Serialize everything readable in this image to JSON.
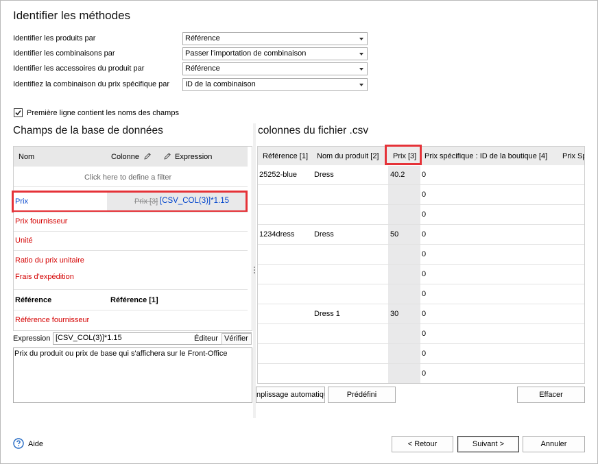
{
  "header": {
    "title": "Identifier les méthodes"
  },
  "methods": [
    {
      "label": "Identifier les produits par",
      "value": "Référence"
    },
    {
      "label": "Identifier les combinaisons par",
      "value": "Passer l'importation de combinaison"
    },
    {
      "label": "Identifier les accessoires du produit par",
      "value": "Référence"
    },
    {
      "label": "Identifiez la combinaison du prix spécifique par",
      "value": "ID de la combinaison"
    }
  ],
  "first_line_checkbox": {
    "label": "Première ligne contient les noms des champs",
    "checked": true
  },
  "db_fields": {
    "title": "Champs de la base de données",
    "col_name": "Nom",
    "col_column": "Colonne",
    "col_expression": "Expression",
    "filter_hint": "Click here to define a filter",
    "rows": [
      {
        "name": "Prix",
        "column": "Prix [3]",
        "expression": "[CSV_COL(3)]*1.15"
      },
      {
        "name": "Prix fournisseur",
        "column": "",
        "expression": ""
      },
      {
        "name": "Unité",
        "column": "",
        "expression": ""
      },
      {
        "name": "Ratio du prix unitaire",
        "column": "",
        "expression": ""
      },
      {
        "name": "Frais d'expédition",
        "column": "",
        "expression": ""
      },
      {
        "name": "Référence",
        "column": "Référence [1]",
        "expression": ""
      },
      {
        "name": "Référence fournisseur",
        "column": "",
        "expression": ""
      }
    ]
  },
  "expression_bar": {
    "label": "Expression",
    "value": "[CSV_COL(3)]*1.15",
    "editor_label": "Éditeur",
    "verify_label": "Vérifier"
  },
  "description": "Prix du produit ou prix de base qui s'affichera sur le Front-Office",
  "csv": {
    "title": "colonnes du fichier .csv",
    "headers": [
      "Référence [1]",
      "Nom du produit [2]",
      "Prix [3]",
      "Prix spécifique : ID de la boutique [4]",
      "Prix Sp"
    ],
    "rows": [
      [
        "25252-blue",
        "Dress",
        "40.2",
        "0"
      ],
      [
        "",
        "",
        "",
        "0"
      ],
      [
        "",
        "",
        "",
        "0"
      ],
      [
        "1234dress",
        "Dress",
        "50",
        "0"
      ],
      [
        "",
        "",
        "",
        "0"
      ],
      [
        "",
        "",
        "",
        "0"
      ],
      [
        "",
        "",
        "",
        "0"
      ],
      [
        "",
        "Dress 1",
        "30",
        "0"
      ],
      [
        "",
        "",
        "",
        "0"
      ],
      [
        "",
        "",
        "",
        "0"
      ],
      [
        "",
        "",
        "",
        "0"
      ]
    ]
  },
  "csv_buttons": {
    "autofill": "nplissage automatiqu",
    "predefined": "Prédéfini",
    "clear": "Effacer"
  },
  "footer": {
    "help": "Aide",
    "back": "< Retour",
    "next": "Suivant >",
    "cancel": "Annuler"
  },
  "icons": {
    "help": "help-icon",
    "pencil": "pencil-icon",
    "check": "checkmark-icon",
    "dropdown": "chevron-down-icon",
    "splitter": "splitter-grip-icon"
  },
  "colors": {
    "required_field": "#d40000",
    "highlight": "#e53238",
    "link": "#0044cc"
  }
}
